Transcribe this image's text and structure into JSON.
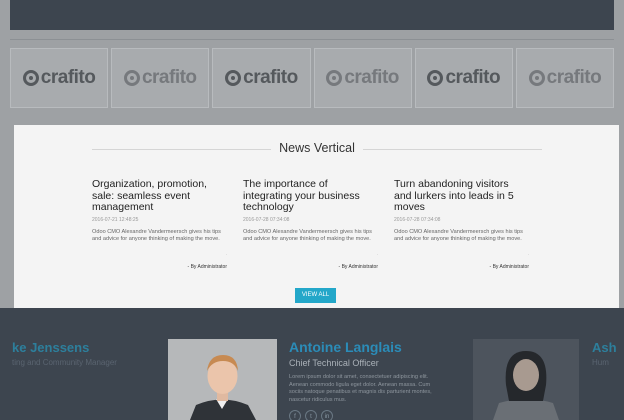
{
  "partners": {
    "logos": [
      {
        "name": "crafito",
        "faded": false
      },
      {
        "name": "crafito",
        "faded": true
      },
      {
        "name": "crafito",
        "faded": false
      },
      {
        "name": "crafito",
        "faded": true
      },
      {
        "name": "crafito",
        "faded": false
      },
      {
        "name": "crafito",
        "faded": true
      }
    ]
  },
  "news_modal": {
    "title": "News Vertical",
    "items": [
      {
        "title": "Organization, promotion, sale: seamless event management",
        "date": "2016-07-21 12:48:25",
        "excerpt": "Odoo CMO Alexandre Vandermeersch gives his tips and advice for anyone thinking of making the move.",
        "author": "- By Administrator"
      },
      {
        "title": "The importance of integrating your business technology",
        "date": "2016-07-28 07:34:08",
        "excerpt": "Odoo CMO Alexandre Vandermeersch gives his tips and advice for anyone thinking of making the move.",
        "author": "- By Administrator"
      },
      {
        "title": "Turn abandoning visitors and lurkers into leads in 5 moves",
        "date": "2016-07-28 07:34:08",
        "excerpt": "Odoo CMO Alexandre Vandermeersch gives his tips and advice for anyone thinking of making the move.",
        "author": "- By Administrator"
      }
    ],
    "view_all_label": "VIEW ALL"
  },
  "team": {
    "left_name": "ke Jenssens",
    "left_role": "ting and Community Manager",
    "featured_name": "Antoine Langlais",
    "featured_role": "Chief Technical Officer",
    "featured_text": "Lorem ipsum dolor sit amet, consectetuer adipiscing elit. Aenean commodo ligula eget dolor. Aenean massa. Cum sociis natoque penatibus et magnis dis parturient montes, nascetur ridiculus mus.",
    "right_name": "Ash",
    "right_role": "Hum",
    "socials": [
      "f",
      "t",
      "in"
    ]
  },
  "colors": {
    "accent": "#23a7c9",
    "overlay": "#9ea1a4",
    "dark": "#3d454f"
  }
}
